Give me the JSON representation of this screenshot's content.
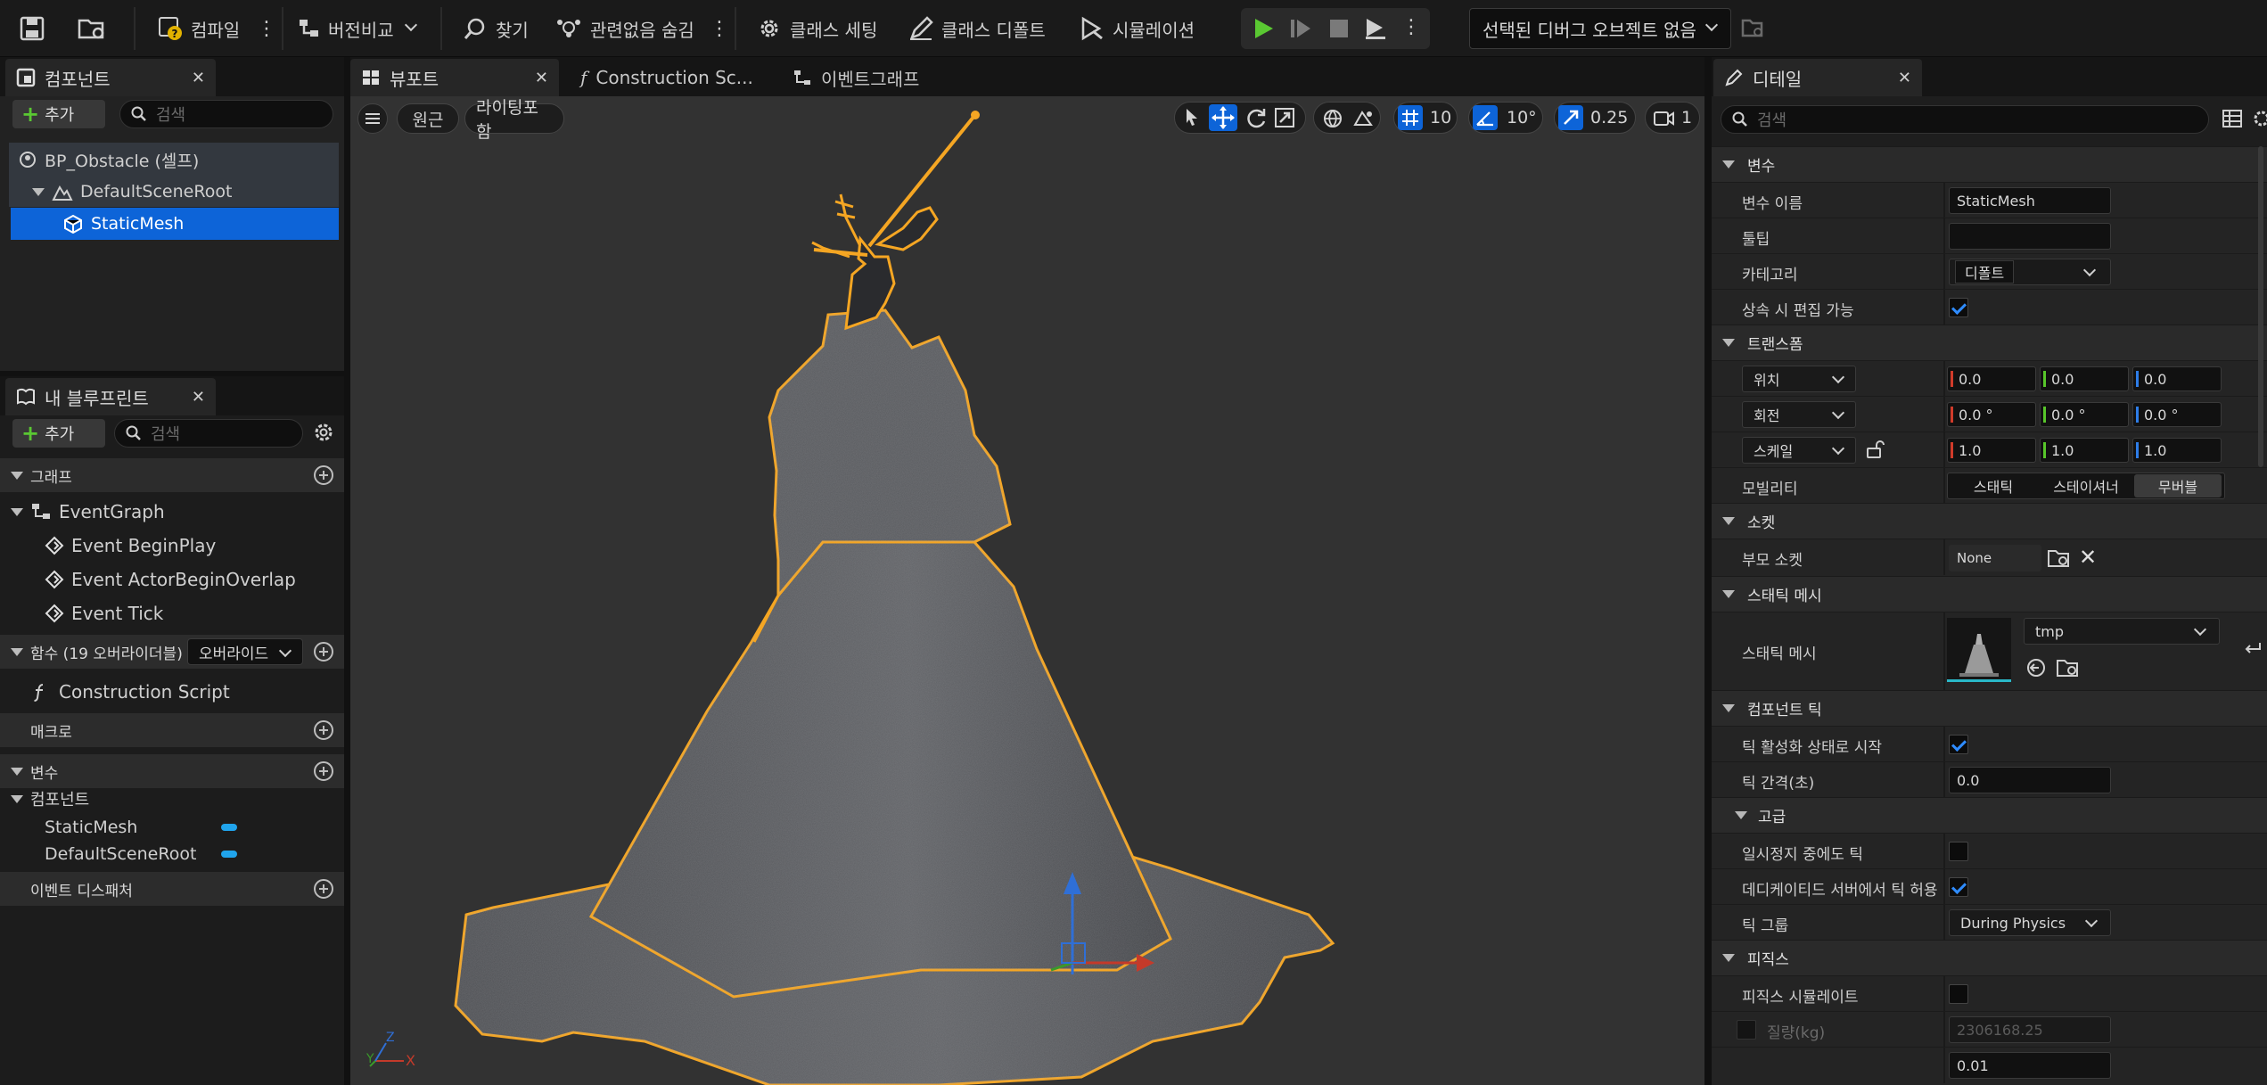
{
  "toolbar": {
    "compile": "컴파일",
    "diff": "버전비교",
    "find": "찾기",
    "hide_unrelated": "관련없음 숨김",
    "class_settings": "클래스 세팅",
    "class_defaults": "클래스 디폴트",
    "simulation": "시뮬레이션",
    "debug_object": "선택된 디버그 오브젝트 없음"
  },
  "components": {
    "tab": "컴포넌트",
    "add": "추가",
    "search_placeholder": "검색",
    "tree": [
      "BP_Obstacle (셀프)",
      "DefaultSceneRoot",
      "StaticMesh"
    ]
  },
  "my_blueprint": {
    "tab": "내 블루프린트",
    "add": "추가",
    "search_placeholder": "검색",
    "graph_header": "그래프",
    "event_graph": "EventGraph",
    "events": [
      "Event BeginPlay",
      "Event ActorBeginOverlap",
      "Event Tick"
    ],
    "functions_header": "함수 (19 오버라이더블)",
    "override": "오버라이드",
    "construction_script": "Construction Script",
    "macros_header": "매크로",
    "variables_header": "변수",
    "components_group": "컴포넌트",
    "component_vars": [
      "StaticMesh",
      "DefaultSceneRoot"
    ],
    "dispatchers_header": "이벤트 디스패처"
  },
  "center_tabs": [
    "뷰포트",
    "Construction Sc...",
    "이벤트그래프"
  ],
  "viewport": {
    "perspective": "원근",
    "lighting": "라이팅포함",
    "grid_snap": "10",
    "rot_snap": "10°",
    "scale_snap": "0.25",
    "camera_speed": "1",
    "axis_x": "X",
    "axis_y": "Y",
    "axis_z": "Z"
  },
  "details": {
    "tab": "디테일",
    "search_placeholder": "검색",
    "sections": {
      "variable": "변수",
      "transform": "트랜스폼",
      "sockets": "소켓",
      "static_mesh": "스태틱 메시",
      "component_tick": "컴포넌트 틱",
      "advanced": "고급",
      "physics": "피직스"
    },
    "var_name_label": "변수 이름",
    "var_name": "StaticMesh",
    "tooltip_label": "툴팁",
    "tooltip_value": "",
    "category_label": "카테고리",
    "category": "디폴트",
    "editable_inherit_label": "상속 시 편집 가능",
    "location_label": "위치",
    "location": [
      "0.0",
      "0.0",
      "0.0"
    ],
    "rotation_label": "회전",
    "rotation": [
      "0.0 °",
      "0.0 °",
      "0.0 °"
    ],
    "scale_label": "스케일",
    "scale": [
      "1.0",
      "1.0",
      "1.0"
    ],
    "mobility_label": "모빌리티",
    "mobility_options": [
      "스태틱",
      "스테이셔너",
      "무버블"
    ],
    "mobility_selected": "무버블",
    "parent_socket_label": "부모 소켓",
    "parent_socket": "None",
    "static_mesh_label": "스태틱 메시",
    "static_mesh": "tmp",
    "start_with_tick_label": "틱 활성화 상태로 시작",
    "tick_interval_label": "틱 간격(초)",
    "tick_interval": "0.0",
    "tick_paused_label": "일시정지 중에도 틱",
    "dedicated_tick_label": "데디케이티드 서버에서 틱 허용",
    "tick_group_label": "틱 그룹",
    "tick_group": "During Physics",
    "simulate_physics_label": "피직스 시뮬레이트",
    "mass_label": "질량(kg)",
    "mass": "2306168.25",
    "linear_damping_value": "0.01"
  },
  "colors": {
    "selection_blue": "#0d64d8",
    "outline_orange": "#f5a623",
    "play_green": "#5ac832",
    "component_pill": "#20a4ec"
  }
}
